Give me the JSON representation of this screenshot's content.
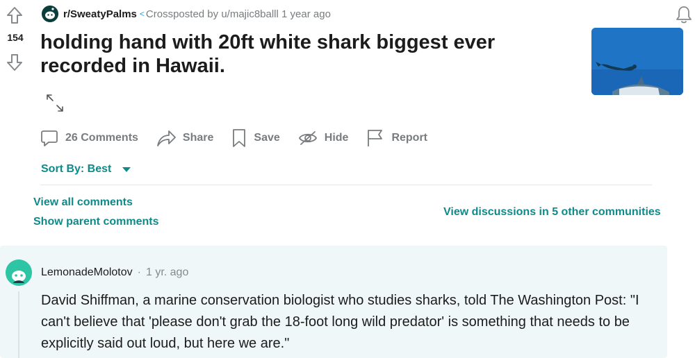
{
  "vote": {
    "score": "154"
  },
  "post": {
    "subreddit": "r/SweatyPalms",
    "crosspost_label": "Crossposted by",
    "crosspost_user": "u/majic8balll",
    "time": "1 year ago",
    "title": "holding hand with 20ft white shark biggest ever recorded in Hawaii."
  },
  "actions": {
    "comments": "26 Comments",
    "share": "Share",
    "save": "Save",
    "hide": "Hide",
    "report": "Report"
  },
  "sort": {
    "label": "Sort By: Best"
  },
  "links": {
    "view_all": "View all comments",
    "show_parent": "Show parent comments",
    "view_discussions": "View discussions in 5 other communities"
  },
  "comment": {
    "author": "LemonadeMolotov",
    "separator": "·",
    "time": "1 yr. ago",
    "body": "David Shiffman, a marine conservation biologist who studies sharks, told The Washington Post: \"I can't believe that 'please don't grab the 18-foot long wild predator' is something that needs to be explicitly said out loud, but here we are.\""
  },
  "colors": {
    "accent_teal": "#0e8a8a",
    "meta_gray": "#787c7e",
    "comment_bg": "#f0f7f8",
    "crosspost_blue": "#24a0ed"
  },
  "icons": [
    "upvote-icon",
    "downvote-icon",
    "subreddit-avatar-icon",
    "crosspost-icon",
    "bell-icon",
    "expand-icon",
    "comment-icon",
    "share-icon",
    "save-icon",
    "hide-icon",
    "report-icon",
    "caret-down-icon",
    "user-avatar-icon"
  ]
}
